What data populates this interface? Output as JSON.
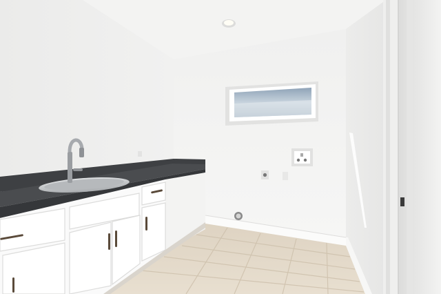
{
  "scene": {
    "subject": "laundry-room",
    "colors": {
      "ceiling": "#f3f3f2",
      "left_wall": "#eeeeee",
      "back_wall": "#f4f4f4",
      "right_wall": "#ededec",
      "floor_tile": "#e4d9c8",
      "grout": "#d2c6b4",
      "countertop": "#47494c",
      "backsplash": "#3e4043",
      "cabinet": "#fafafa",
      "cabinet_shadow": "#e3e3e2",
      "handle": "#5a4a3a",
      "sink": "#c9cbcd",
      "window_sky": "#a9b8c6",
      "door_frame": "#e9e9e8"
    },
    "icons": [
      "ceiling-light-icon",
      "window-icon",
      "faucet-icon",
      "sink-icon",
      "washer-box-icon",
      "electrical-outlet-icon",
      "dryer-vent-icon",
      "door-latch-icon"
    ]
  }
}
